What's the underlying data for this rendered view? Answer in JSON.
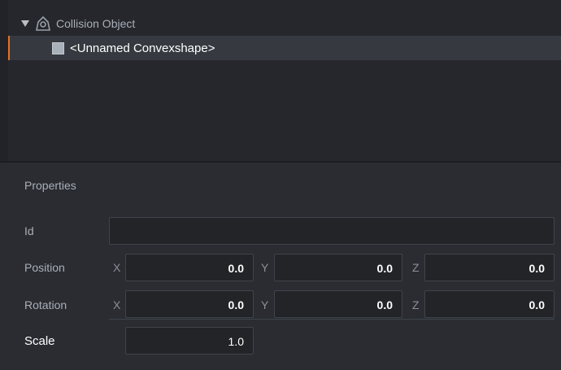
{
  "outline": {
    "root_label": "Collision Object",
    "child_label": "<Unnamed Convexshape>",
    "root_icon": "collision-object-icon",
    "child_icon": "convexshape-icon",
    "selection_color": "#e86f25"
  },
  "properties": {
    "title": "Properties",
    "id": {
      "label": "Id",
      "value": ""
    },
    "position": {
      "label": "Position",
      "x": "0.0",
      "y": "0.0",
      "z": "0.0"
    },
    "rotation": {
      "label": "Rotation",
      "x": "0.0",
      "y": "0.0",
      "z": "0.0"
    },
    "scale": {
      "label": "Scale",
      "value": "1.0"
    },
    "axes": {
      "x": "X",
      "y": "Y",
      "z": "Z"
    }
  }
}
